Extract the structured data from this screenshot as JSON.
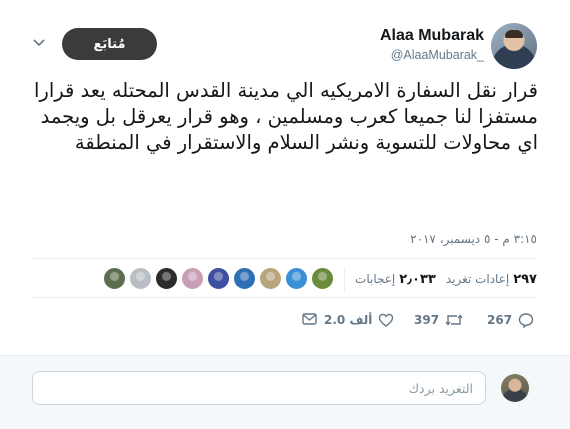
{
  "author": {
    "name": "Alaa Mubarak",
    "handle": "@AlaaMubarak_"
  },
  "follow_button": {
    "label": "مُتابَع"
  },
  "tweet": {
    "text": "قرار نقل السفارة الامريكيه الي مدينة القدس المحتله يعد قرارا مستفزا  لنا جميعا كعرب ومسلمين ، وهو قرار  يعرقل بل ويجمد اي محاولات للتسوية ونشر السلام والاستقرار في المنطقة",
    "timestamp": "٣:١٥ م - ٥ ديسمبر، ٢٠١٧"
  },
  "stats": {
    "retweets_count": "٢٩٧",
    "retweets_label": "إعادات تغريد",
    "likes_count": "٢٫٠٣٣",
    "likes_label": "إعجابات"
  },
  "liker_avatars": [
    {
      "name": "liker-1",
      "color": "#6a8a3c"
    },
    {
      "name": "liker-2",
      "color": "#3b8fd6"
    },
    {
      "name": "liker-3",
      "color": "#b9a57c"
    },
    {
      "name": "liker-4",
      "color": "#2d6fb5"
    },
    {
      "name": "liker-5",
      "color": "#3c4fa0"
    },
    {
      "name": "liker-6",
      "color": "#c7a0b8"
    },
    {
      "name": "liker-7",
      "color": "#2b2b2b"
    },
    {
      "name": "liker-8",
      "color": "#b8bec4"
    },
    {
      "name": "liker-9",
      "color": "#5b6e4f"
    }
  ],
  "actions": {
    "reply_count": "267",
    "retweet_count": "397",
    "like_count": "2.0 ألف"
  },
  "reply": {
    "placeholder": "التغريد بردك"
  },
  "colors": {
    "follow_bg": "#3b3b3b",
    "muted": "#657786",
    "divider": "#e6ecf0"
  },
  "icons": [
    "chevron-down-icon",
    "reply-icon",
    "retweet-icon",
    "heart-icon",
    "message-icon"
  ]
}
